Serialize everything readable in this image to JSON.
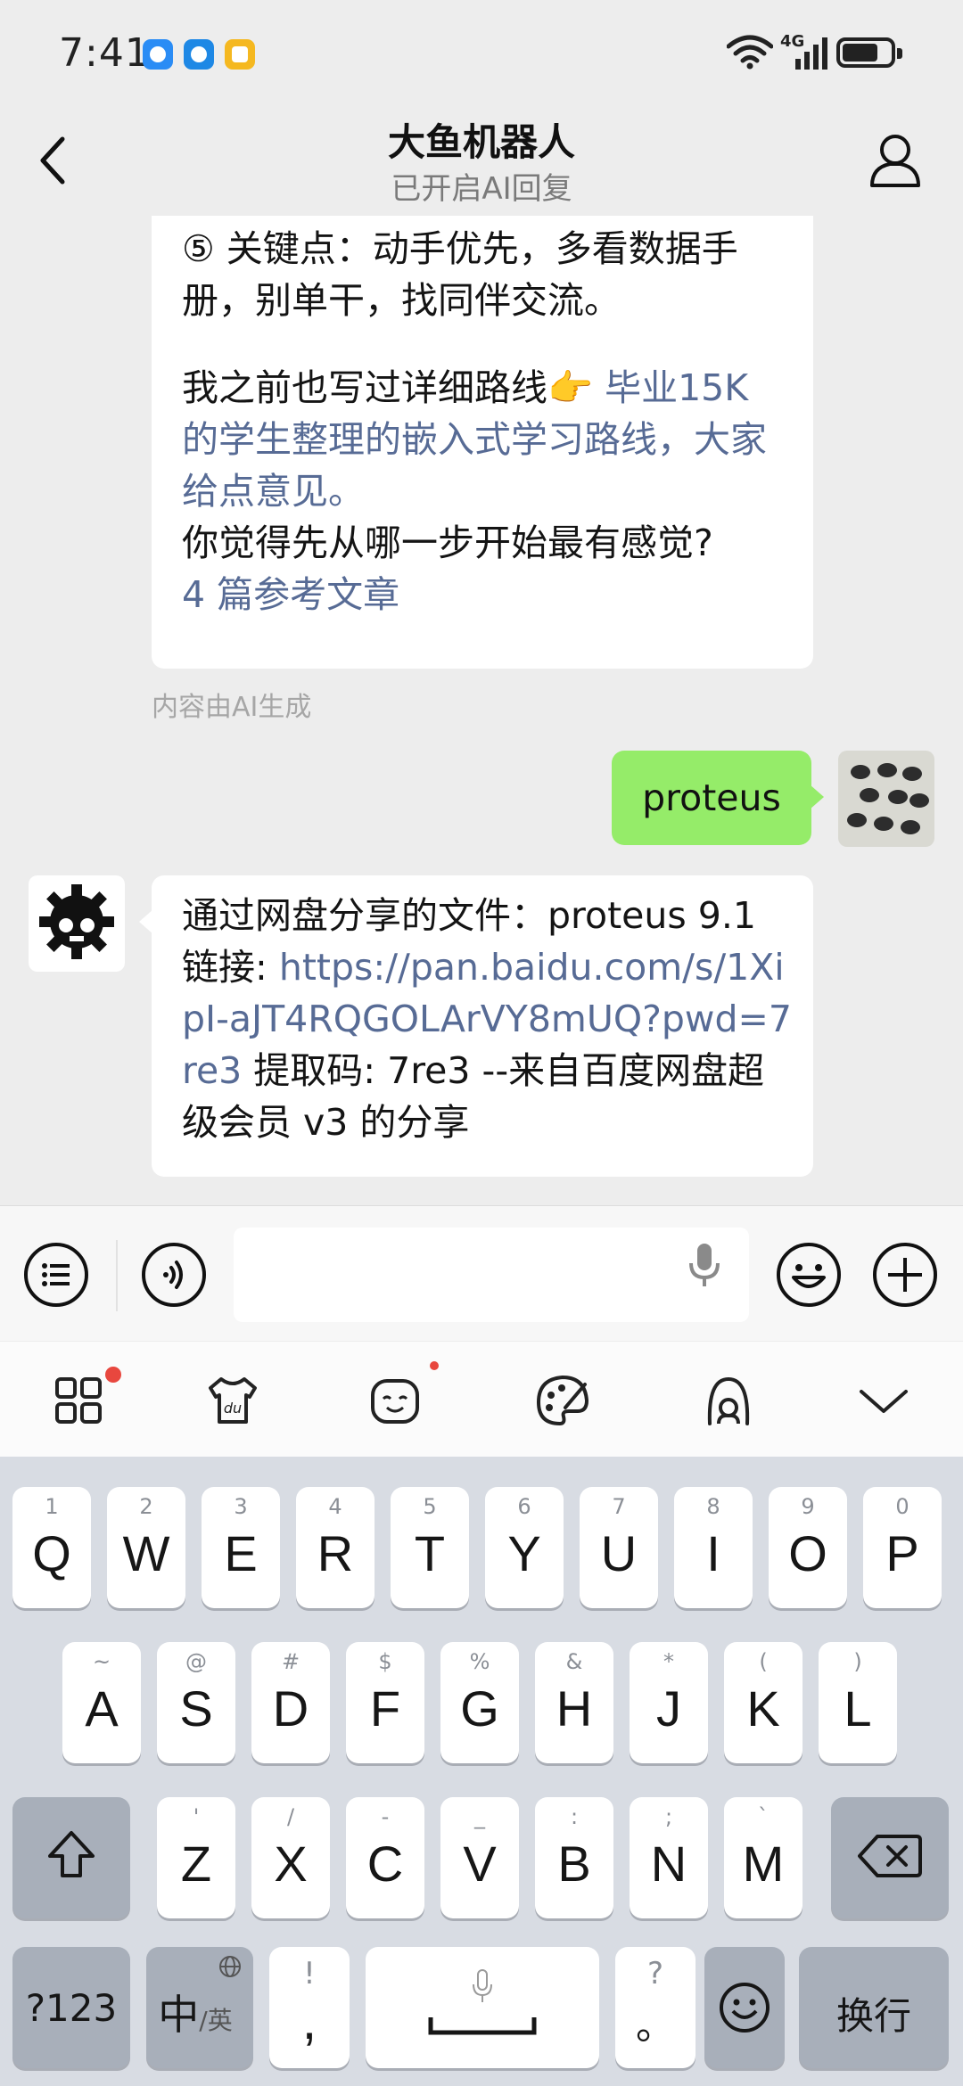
{
  "status_bar": {
    "time": "7:41",
    "network": "4G",
    "battery_level": 0.75,
    "app_icons": [
      "message-app-icon",
      "search-app-icon",
      "chat-app-icon"
    ]
  },
  "header": {
    "title": "大鱼机器人",
    "subtitle": "已开启AI回复"
  },
  "messages": {
    "bot_message_1": {
      "line1": "⑤ 关键点：动手优先，多看数据手册，别单干，找同伴交流。",
      "line2": "我之前也写过详细路线👉 ",
      "link_text": "毕业15K 的学生整理的嵌入式学习路线，大家给点意见。",
      "line3": "你觉得先从哪一步开始最有感觉?",
      "references": "4 篇参考文章"
    },
    "ai_note": "内容由AI生成",
    "user_message": "proteus",
    "bot_message_2": {
      "prefix": "通过网盘分享的文件：proteus 9.1 链接: ",
      "url": "https://pan.baidu.com/s/1XipI-aJT4RQGOLArVY8mUQ?pwd=7re3",
      "suffix": " 提取码: 7re3 --来自百度网盘超级会员 v3 的分享"
    }
  },
  "input": {
    "placeholder": ""
  },
  "keyboard": {
    "row1": [
      {
        "hint": "1",
        "key": "Q"
      },
      {
        "hint": "2",
        "key": "W"
      },
      {
        "hint": "3",
        "key": "E"
      },
      {
        "hint": "4",
        "key": "R"
      },
      {
        "hint": "5",
        "key": "T"
      },
      {
        "hint": "6",
        "key": "Y"
      },
      {
        "hint": "7",
        "key": "U"
      },
      {
        "hint": "8",
        "key": "I"
      },
      {
        "hint": "9",
        "key": "O"
      },
      {
        "hint": "0",
        "key": "P"
      }
    ],
    "row2": [
      {
        "hint": "~",
        "key": "A"
      },
      {
        "hint": "@",
        "key": "S"
      },
      {
        "hint": "#",
        "key": "D"
      },
      {
        "hint": "$",
        "key": "F"
      },
      {
        "hint": "%",
        "key": "G"
      },
      {
        "hint": "&",
        "key": "H"
      },
      {
        "hint": "*",
        "key": "J"
      },
      {
        "hint": "(",
        "key": "K"
      },
      {
        "hint": ")",
        "key": "L"
      }
    ],
    "row3": [
      {
        "hint": "'",
        "key": "Z"
      },
      {
        "hint": "/",
        "key": "X"
      },
      {
        "hint": "-",
        "key": "C"
      },
      {
        "hint": "_",
        "key": "V"
      },
      {
        "hint": ":",
        "key": "B"
      },
      {
        "hint": ";",
        "key": "N"
      },
      {
        "hint": "`",
        "key": "M"
      }
    ],
    "numeric_label": "?123",
    "lang_label": "中",
    "lang_sub": "/英",
    "comma_hint": "!",
    "comma_key": ",",
    "period_hint": "?",
    "period_key": "。",
    "enter_label": "换行"
  }
}
